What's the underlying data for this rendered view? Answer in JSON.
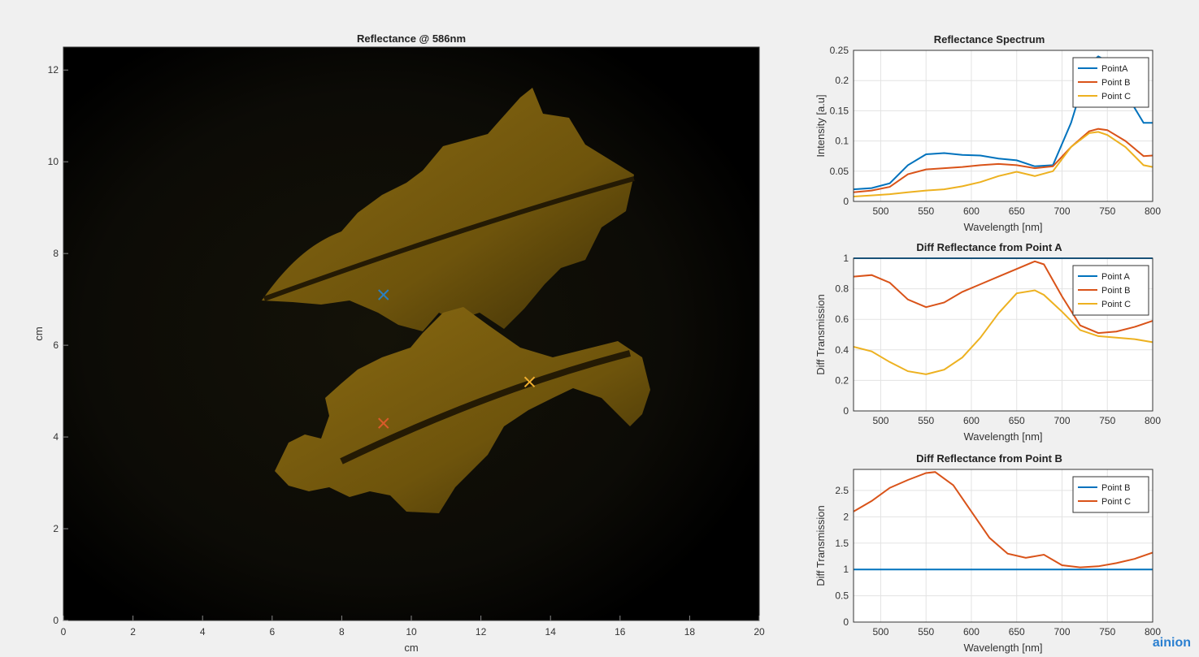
{
  "watermark": "ainion",
  "chart_data": [
    {
      "type": "image",
      "title": "Reflectance @ 586nm",
      "xlabel": "cm",
      "ylabel": "cm",
      "xlim": [
        0,
        20
      ],
      "ylim": [
        0,
        12.5
      ],
      "xticks": [
        "0",
        "2",
        "4",
        "6",
        "8",
        "10",
        "12",
        "14",
        "16",
        "18",
        "20"
      ],
      "yticks": [
        "0",
        "2",
        "4",
        "6",
        "8",
        "10",
        "12"
      ],
      "markers": [
        {
          "name": "Point A",
          "x": 9.2,
          "y": 7.1,
          "color": "#2a7fc0"
        },
        {
          "name": "Point B",
          "x": 9.2,
          "y": 4.3,
          "color": "#d85a2a"
        },
        {
          "name": "Point C",
          "x": 13.4,
          "y": 5.2,
          "color": "#f2b030"
        }
      ]
    },
    {
      "type": "line",
      "title": "Reflectance Spectrum",
      "xlabel": "Wavelength [nm]",
      "ylabel": "Intensity [a.u]",
      "xlim": [
        470,
        800
      ],
      "ylim": [
        0,
        0.25
      ],
      "xticks": [
        "500",
        "550",
        "600",
        "650",
        "700",
        "750",
        "800"
      ],
      "yticks": [
        "0",
        "0.05",
        "0.1",
        "0.15",
        "0.2",
        "0.25"
      ],
      "legend_position": "top-right",
      "x": [
        470,
        490,
        510,
        530,
        550,
        570,
        590,
        610,
        630,
        650,
        670,
        690,
        710,
        730,
        740,
        750,
        770,
        790,
        800
      ],
      "series": [
        {
          "name": "PointA",
          "color": "#0072bd",
          "values": [
            0.02,
            0.022,
            0.03,
            0.06,
            0.078,
            0.08,
            0.077,
            0.076,
            0.071,
            0.068,
            0.058,
            0.06,
            0.13,
            0.228,
            0.24,
            0.232,
            0.18,
            0.13,
            0.13
          ]
        },
        {
          "name": "Point B",
          "color": "#d95319",
          "values": [
            0.015,
            0.018,
            0.024,
            0.045,
            0.053,
            0.055,
            0.057,
            0.06,
            0.062,
            0.06,
            0.055,
            0.058,
            0.09,
            0.116,
            0.12,
            0.118,
            0.1,
            0.075,
            0.076
          ]
        },
        {
          "name": "Point C",
          "color": "#edb120",
          "values": [
            0.008,
            0.01,
            0.012,
            0.015,
            0.018,
            0.02,
            0.025,
            0.032,
            0.042,
            0.049,
            0.042,
            0.05,
            0.09,
            0.113,
            0.115,
            0.11,
            0.09,
            0.06,
            0.057
          ]
        }
      ]
    },
    {
      "type": "line",
      "title": "Diff Reflectance from Point A",
      "xlabel": "Wavelength [nm]",
      "ylabel": "Diff Transmission",
      "xlim": [
        470,
        800
      ],
      "ylim": [
        0,
        1
      ],
      "xticks": [
        "500",
        "550",
        "600",
        "650",
        "700",
        "750",
        "800"
      ],
      "yticks": [
        "0",
        "0.2",
        "0.4",
        "0.6",
        "0.8",
        "1"
      ],
      "legend_position": "top-right",
      "x": [
        470,
        490,
        510,
        530,
        550,
        570,
        590,
        610,
        630,
        650,
        670,
        680,
        700,
        720,
        740,
        760,
        780,
        800
      ],
      "series": [
        {
          "name": "Point A",
          "color": "#0072bd",
          "values": [
            1,
            1,
            1,
            1,
            1,
            1,
            1,
            1,
            1,
            1,
            1,
            1,
            1,
            1,
            1,
            1,
            1,
            1
          ]
        },
        {
          "name": "Point B",
          "color": "#d95319",
          "values": [
            0.88,
            0.89,
            0.84,
            0.73,
            0.68,
            0.71,
            0.78,
            0.83,
            0.88,
            0.93,
            0.98,
            0.96,
            0.75,
            0.56,
            0.51,
            0.52,
            0.55,
            0.59
          ]
        },
        {
          "name": "Point C",
          "color": "#edb120",
          "values": [
            0.42,
            0.39,
            0.32,
            0.26,
            0.24,
            0.27,
            0.35,
            0.48,
            0.64,
            0.77,
            0.79,
            0.76,
            0.65,
            0.53,
            0.49,
            0.48,
            0.47,
            0.45
          ]
        }
      ]
    },
    {
      "type": "line",
      "title": "Diff Reflectance from Point B",
      "xlabel": "Wavelength [nm]",
      "ylabel": "Diff Transmission",
      "xlim": [
        470,
        800
      ],
      "ylim": [
        0,
        2.9
      ],
      "xticks": [
        "500",
        "550",
        "600",
        "650",
        "700",
        "750",
        "800"
      ],
      "yticks": [
        "0",
        "0.5",
        "1",
        "1.5",
        "2",
        "2.5"
      ],
      "legend_position": "top-right",
      "x": [
        470,
        490,
        510,
        530,
        550,
        560,
        580,
        600,
        620,
        640,
        660,
        680,
        700,
        720,
        740,
        760,
        780,
        800
      ],
      "series": [
        {
          "name": "Point B",
          "color": "#0072bd",
          "values": [
            1,
            1,
            1,
            1,
            1,
            1,
            1,
            1,
            1,
            1,
            1,
            1,
            1,
            1,
            1,
            1,
            1,
            1
          ]
        },
        {
          "name": "Point C",
          "color": "#d95319",
          "values": [
            2.1,
            2.3,
            2.55,
            2.7,
            2.83,
            2.85,
            2.6,
            2.1,
            1.6,
            1.3,
            1.22,
            1.28,
            1.08,
            1.04,
            1.06,
            1.12,
            1.2,
            1.32
          ]
        }
      ]
    }
  ]
}
